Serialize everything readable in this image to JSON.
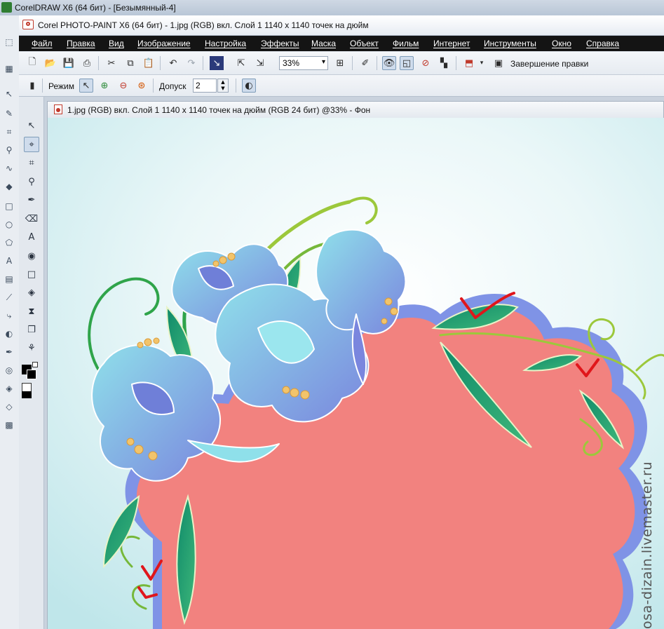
{
  "outer_window": {
    "title": "CorelDRAW X6 (64 бит) - [Безымянный-4]"
  },
  "window": {
    "title": "Corel PHOTO-PAINT X6 (64 бит) - 1.jpg (RGB) вкл. Слой 1 1140 x 1140 точек на дюйм"
  },
  "menu": {
    "items": [
      "Файл",
      "Правка",
      "Вид",
      "Изображение",
      "Настройка",
      "Эффекты",
      "Маска",
      "Объект",
      "Фильм",
      "Интернет",
      "Инструменты",
      "Окно",
      "Справка"
    ]
  },
  "toolbar": {
    "zoom_value": "33%",
    "finish_edit_label": "Завершение правки"
  },
  "property_bar": {
    "mode_label": "Режим",
    "tolerance_label": "Допуск",
    "tolerance_value": "2"
  },
  "document": {
    "title": "1.jpg (RGB) вкл. Слой 1 1140 x 1140 точек на дюйм  (RGB 24 бит) @33% - Фон"
  },
  "watermark": {
    "text": "osa-dizain.livemaster.ru"
  },
  "colors": {
    "menubar_bg": "#141414",
    "canvas_bg": "#dff3f6",
    "plaque_fill": "#f2827f",
    "plaque_border": "#7f93e6",
    "check_marks": "#e0161b"
  }
}
